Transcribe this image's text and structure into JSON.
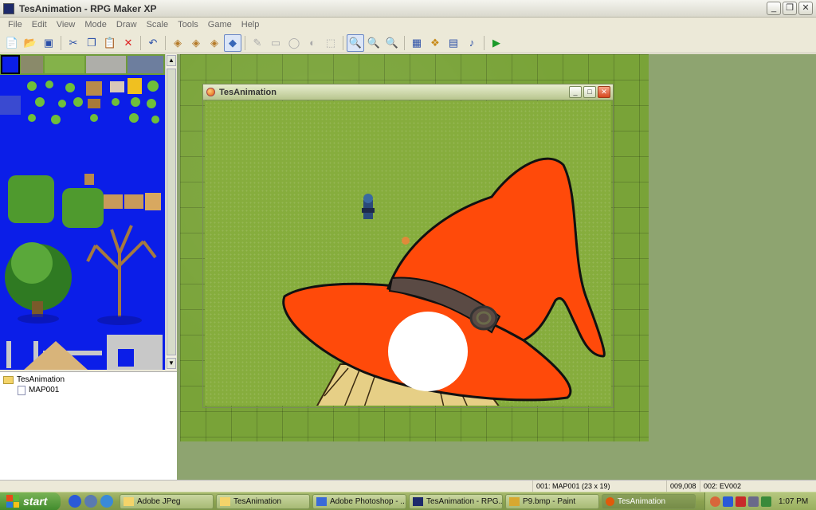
{
  "window": {
    "title": "TesAnimation - RPG Maker XP"
  },
  "menu": [
    "File",
    "Edit",
    "View",
    "Mode",
    "Draw",
    "Scale",
    "Tools",
    "Game",
    "Help"
  ],
  "toolbar": {
    "icons": [
      "new-project-icon",
      "open-project-icon",
      "save-icon",
      "cut-icon",
      "copy-icon",
      "paste-icon",
      "delete-icon",
      "undo-icon",
      "layer1-icon",
      "layer2-icon",
      "layer3-icon",
      "event-layer-icon",
      "pencil-icon",
      "rectangle-icon",
      "ellipse-icon",
      "flood-fill-icon",
      "select-icon",
      "zoom-1x-icon",
      "zoom-half-icon",
      "zoom-quarter-icon",
      "database-icon",
      "materialbase-icon",
      "script-editor-icon",
      "sound-test-icon",
      "playtest-icon"
    ]
  },
  "map_tree": {
    "project": "TesAnimation",
    "maps": [
      "MAP001"
    ]
  },
  "game_window": {
    "title": "TesAnimation"
  },
  "status": {
    "map": "001: MAP001 (23 x 19)",
    "coords": "009,008",
    "event": "002: EV002"
  },
  "taskbar": {
    "start_label": "start",
    "tasks": [
      {
        "label": "Adobe JPeg",
        "active": false
      },
      {
        "label": "TesAnimation",
        "active": false
      },
      {
        "label": "Adobe Photoshop - ...",
        "active": false
      },
      {
        "label": "TesAnimation - RPG...",
        "active": false
      },
      {
        "label": "P9.bmp - Paint",
        "active": false
      },
      {
        "label": "TesAnimation",
        "active": true
      }
    ],
    "clock": "1:07 PM"
  }
}
